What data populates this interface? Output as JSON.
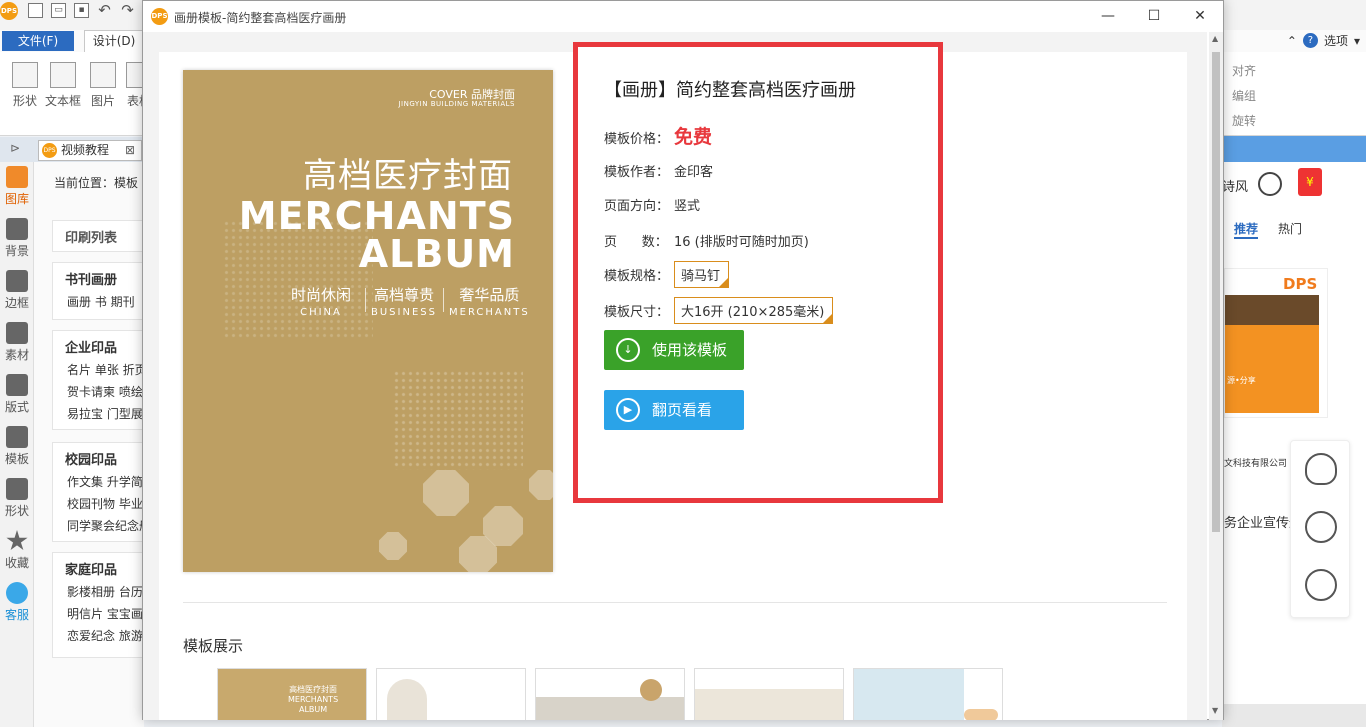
{
  "app": {
    "logo_text": "DPS",
    "menu": {
      "file": "文件(F)",
      "design": "设计(D)",
      "options": "选项"
    },
    "ribbon_tools": [
      "形状",
      "文本框",
      "图片",
      "表格"
    ],
    "ribbon_side": [
      "对齐",
      "编组",
      "旋转"
    ],
    "doc_tab": "视频教程",
    "left_nav": [
      {
        "label": "图库",
        "icon": "gallery-icon",
        "active": true
      },
      {
        "label": "背景",
        "icon": "background-icon"
      },
      {
        "label": "边框",
        "icon": "border-icon"
      },
      {
        "label": "素材",
        "icon": "material-icon"
      },
      {
        "label": "版式",
        "icon": "layout-icon"
      },
      {
        "label": "模板",
        "icon": "template-icon"
      },
      {
        "label": "形状",
        "icon": "shape-icon"
      },
      {
        "label": "收藏",
        "icon": "star-icon"
      },
      {
        "label": "客服",
        "icon": "service-icon"
      }
    ],
    "location": "当前位置：模板",
    "print_list_title": "印刷列表",
    "categories": [
      {
        "title": "书刊画册",
        "lines": [
          "画册  书  期刊"
        ]
      },
      {
        "title": "企业印品",
        "lines": [
          "名片  单张  折页",
          "贺卡请柬  喷绘",
          "易拉宝  门型展"
        ]
      },
      {
        "title": "校园印品",
        "lines": [
          "作文集  升学简",
          "校园刊物  毕业",
          "同学聚会纪念册"
        ]
      },
      {
        "title": "家庭印品",
        "lines": [
          "影楼相册  台历",
          "明信片  宝宝画",
          "恋爱纪念  旅游"
        ]
      }
    ],
    "right_pane": {
      "style_label": "诗风",
      "tabs": [
        "推荐",
        "热门"
      ],
      "thumb_logo": "DPS",
      "thumb_line": "源•分享",
      "company_line": "文科技有限公司",
      "caption": "务企业宣传册"
    }
  },
  "dialog": {
    "logo_text": "DPS",
    "title": "画册模板-简约整套高档医疗画册",
    "window_buttons": {
      "minimize": "—",
      "maximize": "☐",
      "close": "✕"
    },
    "cover": {
      "top_label": "COVER 品牌封面",
      "top_sub": "JINGYIN BUILDING MATERIALS",
      "cn_title": "高档医疗封面",
      "en_line1": "MERCHANTS",
      "en_line2": "ALBUM",
      "tags": [
        {
          "cn": "时尚休闲",
          "en": "CHINA"
        },
        {
          "cn": "高档尊贵",
          "en": "BUSINESS"
        },
        {
          "cn": "奢华品质",
          "en": "MERCHANTS"
        }
      ]
    },
    "info": {
      "title": "【画册】简约整套高档医疗画册",
      "price_label": "模板价格：",
      "price_value": "免费",
      "author_label": "模板作者：",
      "author_value": "金印客",
      "orientation_label": "页面方向：",
      "orientation_value": "竖式",
      "pages_label": "页      数：",
      "pages_value": "16 (排版时可随时加页)",
      "spec_label": "模板规格：",
      "spec_value": "骑马钉",
      "size_label": "模板尺寸：",
      "size_value": "大16开 (210×285毫米)",
      "use_button": "使用该模板",
      "flip_button": "翻页看看"
    },
    "showcase_title": "模板展示",
    "showcase_thumb1_text": "高档医疗封面\nMERCHANTS\nALBUM"
  }
}
